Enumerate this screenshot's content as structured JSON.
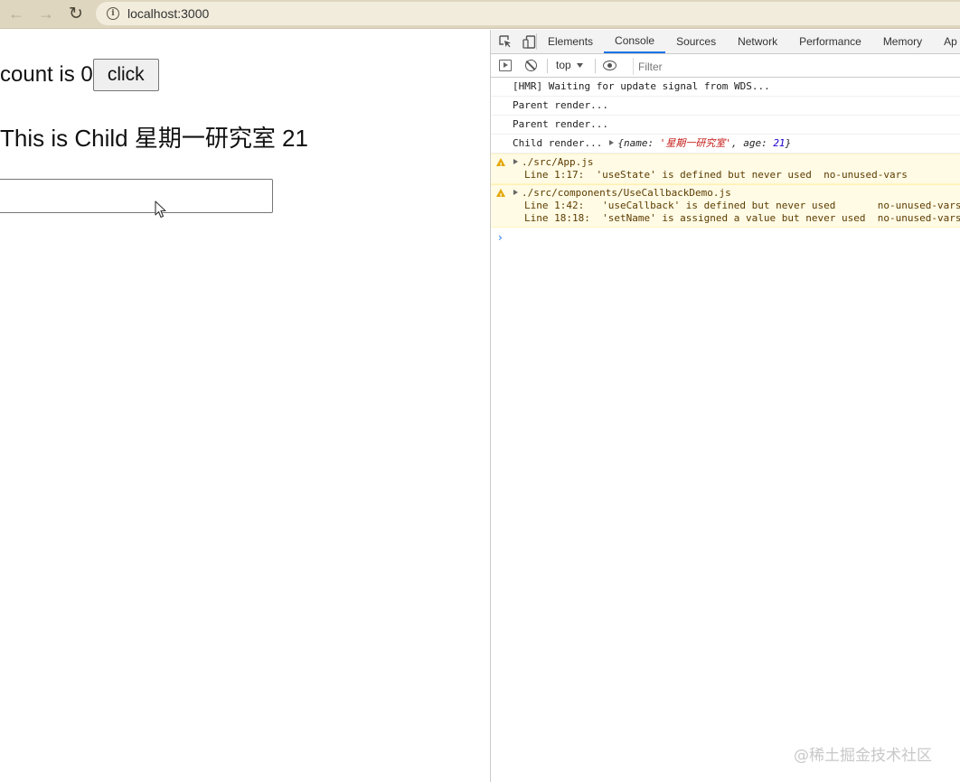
{
  "browser": {
    "url": "localhost:3000",
    "nav_back_glyph": "←",
    "nav_forward_glyph": "→",
    "reload_glyph": "↻"
  },
  "page": {
    "count_text": "count is 0",
    "click_label": "click",
    "child_text": "This is Child 星期一研究室 21",
    "input_value": ""
  },
  "devtools": {
    "tabs": [
      "Elements",
      "Console",
      "Sources",
      "Network",
      "Performance",
      "Memory",
      "Ap"
    ],
    "active_tab": "Console",
    "context": "top",
    "filter_placeholder": "Filter",
    "logs": [
      "[HMR] Waiting for update signal from WDS...",
      "Parent render...",
      "Parent render..."
    ],
    "child_log": {
      "prefix": "Child render...",
      "obj_open": "{name: ",
      "name_value": "'星期一研究室'",
      "obj_mid": ", age: ",
      "age_value": "21",
      "obj_close": "}"
    },
    "warnings": [
      {
        "file": "./src/App.js",
        "lines": [
          "Line 1:17:  'useState' is defined but never used  no-unused-vars"
        ]
      },
      {
        "file": "./src/components/UseCallbackDemo.js",
        "lines": [
          "Line 1:42:   'useCallback' is defined but never used       no-unused-vars",
          "Line 18:18:  'setName' is assigned a value but never used  no-unused-vars"
        ]
      }
    ],
    "prompt_glyph": "›"
  },
  "watermark": "@稀土掘金技术社区",
  "colors": {
    "chrome_bg": "#dfd6bf",
    "active_tab_underline": "#1a73e8",
    "warning_bg": "#fffbe5",
    "warning_icon": "#e4a600"
  }
}
